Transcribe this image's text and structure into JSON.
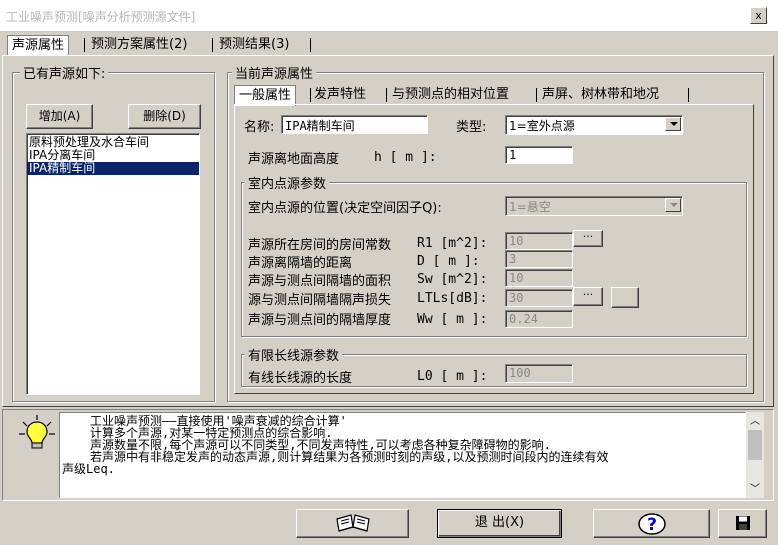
{
  "window": {
    "title": "工业噪声预测[噪声分析预测源文件]",
    "close_glyph": "x"
  },
  "main_tabs": [
    {
      "label": "声源属性"
    },
    {
      "label": "预测方案属性(2)"
    },
    {
      "label": "预测结果(3)"
    }
  ],
  "sources_group": {
    "title": "已有声源如下:",
    "add_label": "增加(A)",
    "delete_label": "删除(D)",
    "items": [
      {
        "label": "原料预处理及水合车间"
      },
      {
        "label": "IPA分离车间"
      },
      {
        "label": "IPA精制车间"
      }
    ]
  },
  "current_group": {
    "title": "当前声源属性",
    "subtabs": [
      {
        "label": "一般属性"
      },
      {
        "label": "发声特性"
      },
      {
        "label": "与预测点的相对位置"
      },
      {
        "label": "声屏、树林带和地况"
      }
    ],
    "name_label": "名称:",
    "name_value": "IPA精制车间",
    "type_label": "类型:",
    "type_value": "1=室外点源",
    "height_label": "声源离地面高度",
    "height_unit": "h [ m ]:",
    "height_value": "1",
    "indoor": {
      "title": "室内点源参数",
      "pos_label": "室内点源的位置(决定空间因子Q):",
      "pos_value": "1=悬空",
      "rows": [
        {
          "label": "声源所在房间的房间常数",
          "unit": "R1 [m^2]:",
          "value": "10"
        },
        {
          "label": "声源离隔墙的距离",
          "unit": "D  [ m ]:",
          "value": "3"
        },
        {
          "label": "声源与测点间隔墙的面积",
          "unit": "Sw [m^2]:",
          "value": "10"
        },
        {
          "label": "源与测点间隔墙隔声损失",
          "unit": "LTLs[dB]:",
          "value": "30"
        },
        {
          "label": "声源与测点间的隔墙厚度",
          "unit": "Ww [ m ]:",
          "value": "0.24"
        }
      ],
      "ellipsis": "···"
    },
    "line_source": {
      "title": "有限长线源参数",
      "label": "有线长线源的长度",
      "unit": "L0 [ m ]:",
      "value": "100"
    }
  },
  "help": {
    "lines": [
      "工业噪声预测——直接使用'噪声衰减的综合计算'",
      "计算多个声源,对某一特定预测点的综合影响.",
      "声源数量不限,每个声源可以不同类型,不同发声特性,可以考虑各种复杂障碍物的影响.",
      "若声源中有非稳定发声的动态声源,则计算结果为各预测时刻的声级,以及预测时间段内的连续有效",
      "声级Leq."
    ]
  },
  "footer": {
    "exit_label": "退 出(X)",
    "help_glyph": "?"
  },
  "colors": {
    "selection": "#0a246a",
    "face": "#d4d0c8",
    "help_blue": "#0000c0"
  }
}
